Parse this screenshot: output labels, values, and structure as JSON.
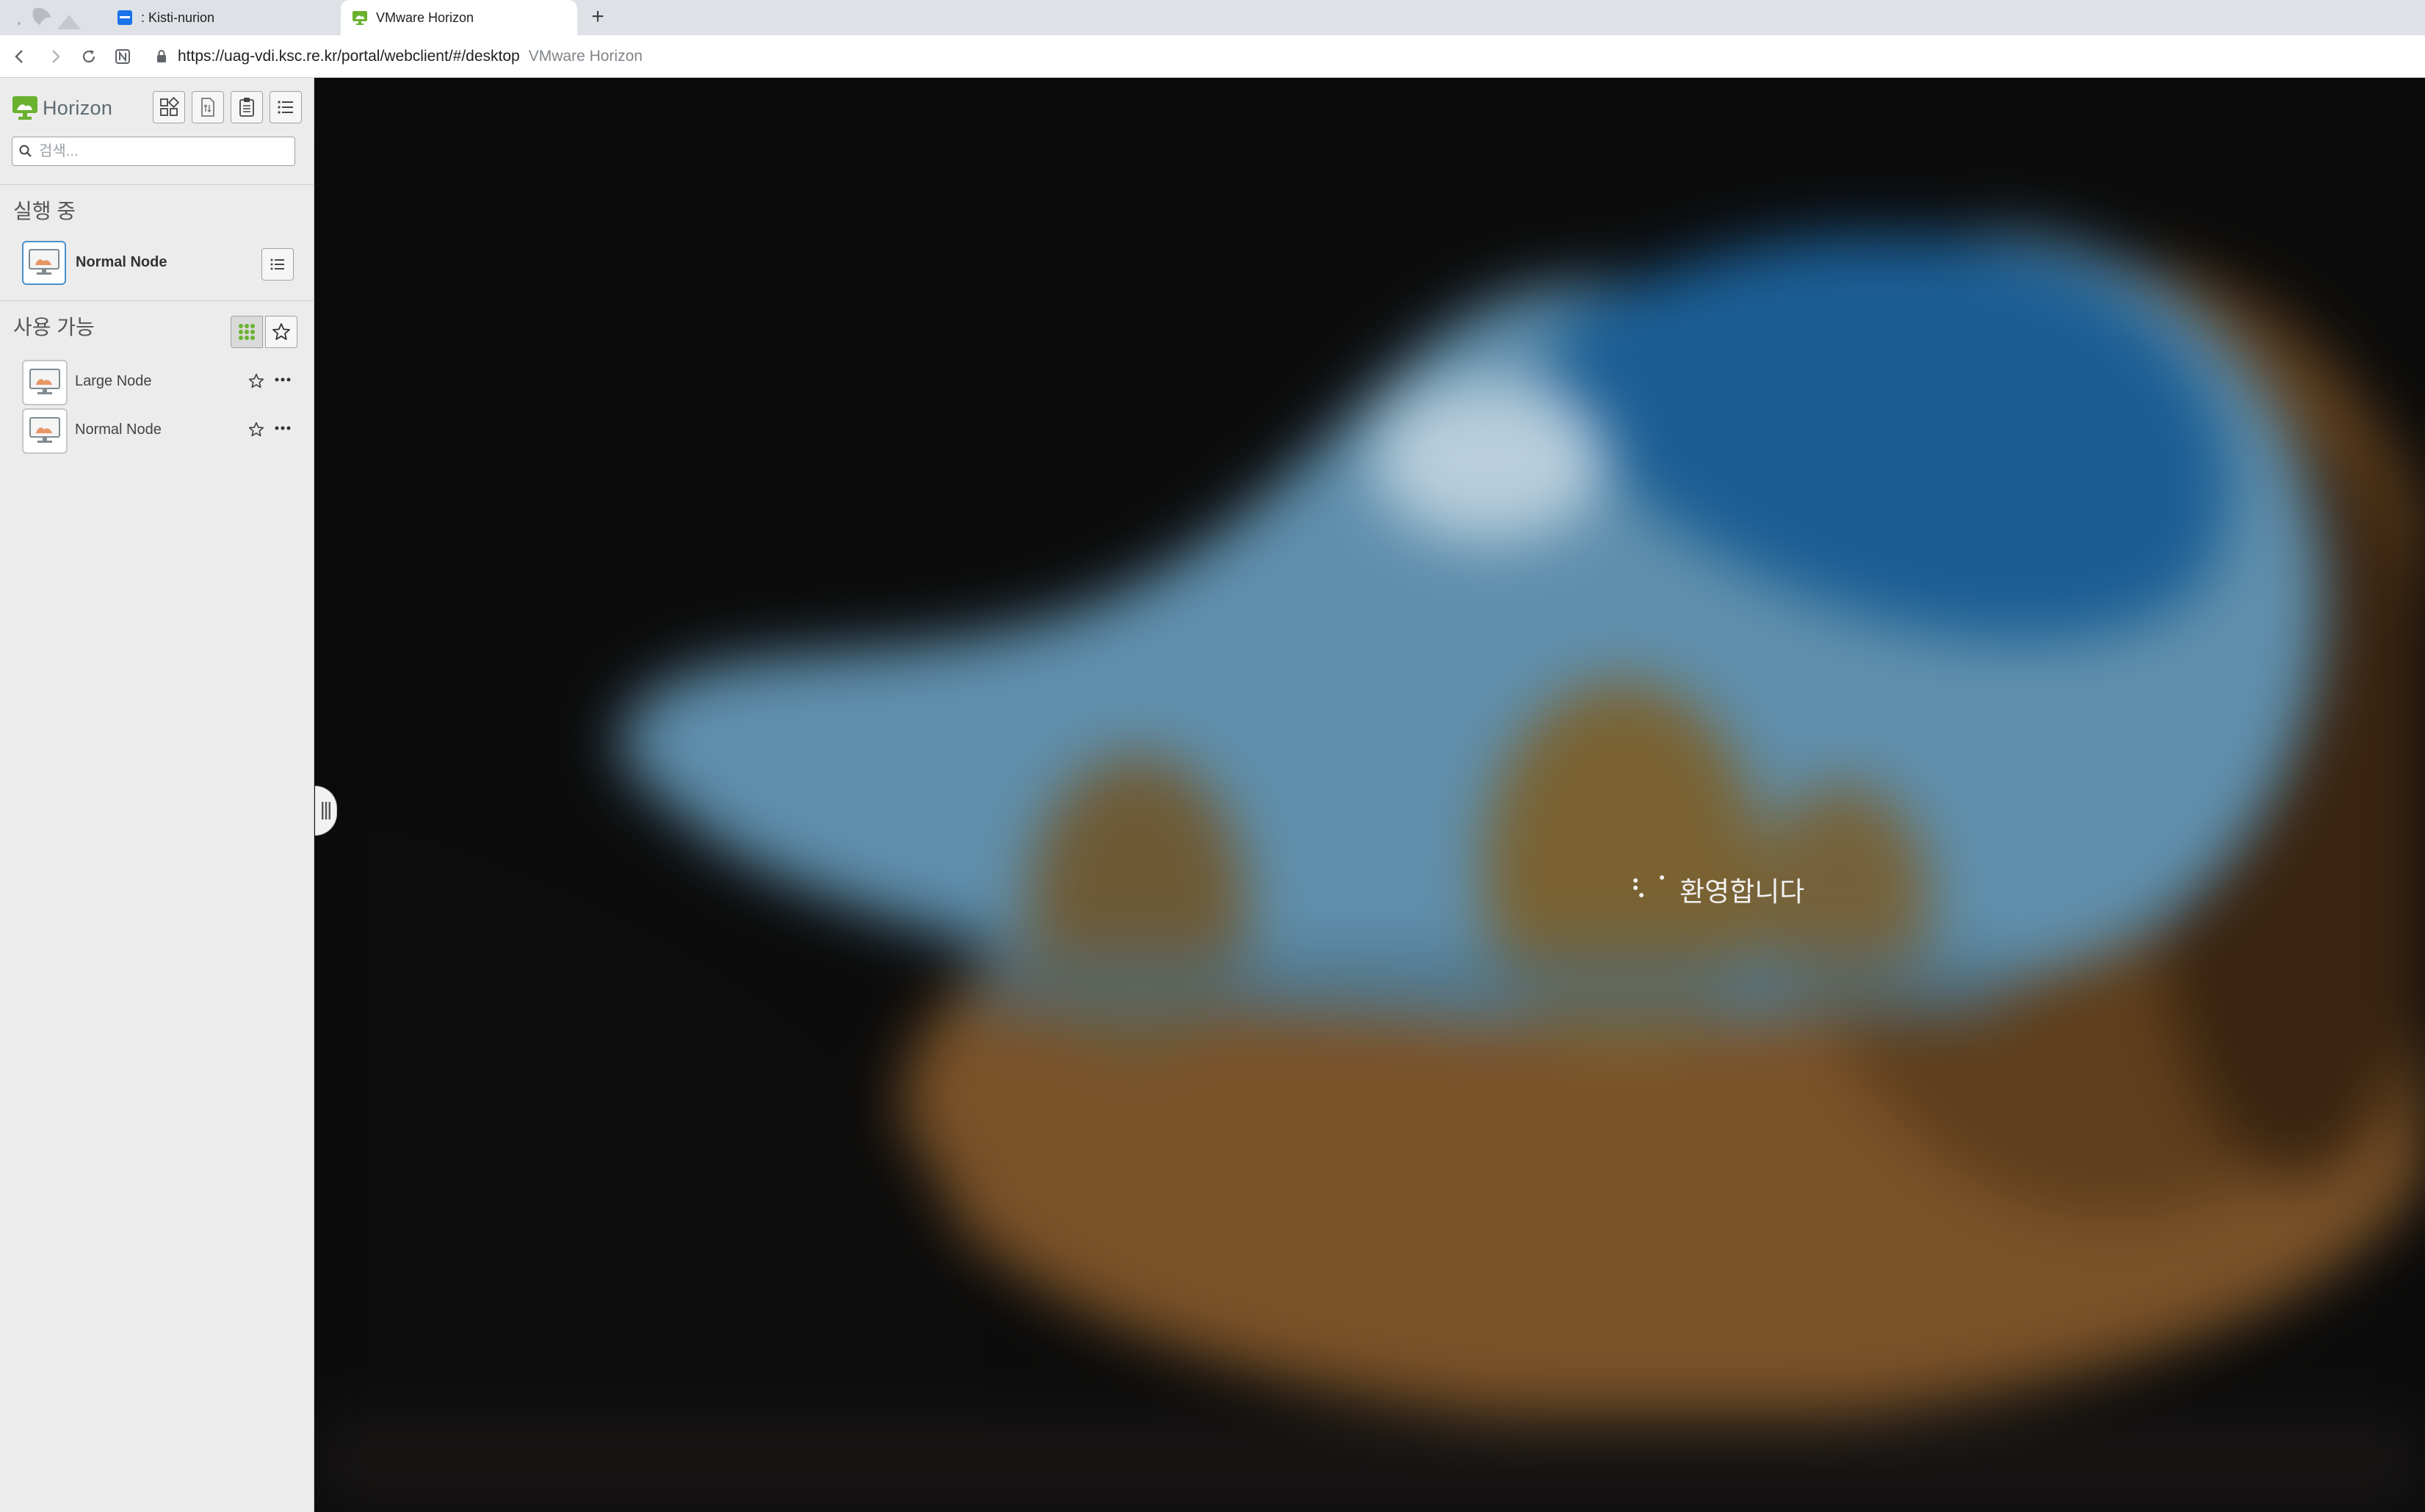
{
  "browser": {
    "tabs": [
      {
        "title": ": Kisti-nurion",
        "active": false,
        "favicon": "kisti-favicon"
      },
      {
        "title": "VMware Horizon",
        "active": true,
        "favicon": "horizon-favicon"
      }
    ],
    "new_tab_label": "+",
    "address": {
      "url": "https://uag-vdi.ksc.re.kr/portal/webclient/#/desktop",
      "page_title": "VMware Horizon"
    }
  },
  "sidebar": {
    "brand": "Horizon",
    "search": {
      "placeholder": "검색...",
      "value": ""
    },
    "running": {
      "title": "실행 중",
      "items": [
        {
          "label": "Normal Node"
        }
      ]
    },
    "available": {
      "title": "사용 가능",
      "items": [
        {
          "label": "Large Node"
        },
        {
          "label": "Normal Node"
        }
      ]
    }
  },
  "desktop": {
    "status_text": "환영합니다"
  },
  "colors": {
    "horizon_green": "#6ab22e",
    "active_border": "#4a90c9",
    "sidebar_bg": "#ececec",
    "desktop_bg": "#0b0b0b"
  }
}
